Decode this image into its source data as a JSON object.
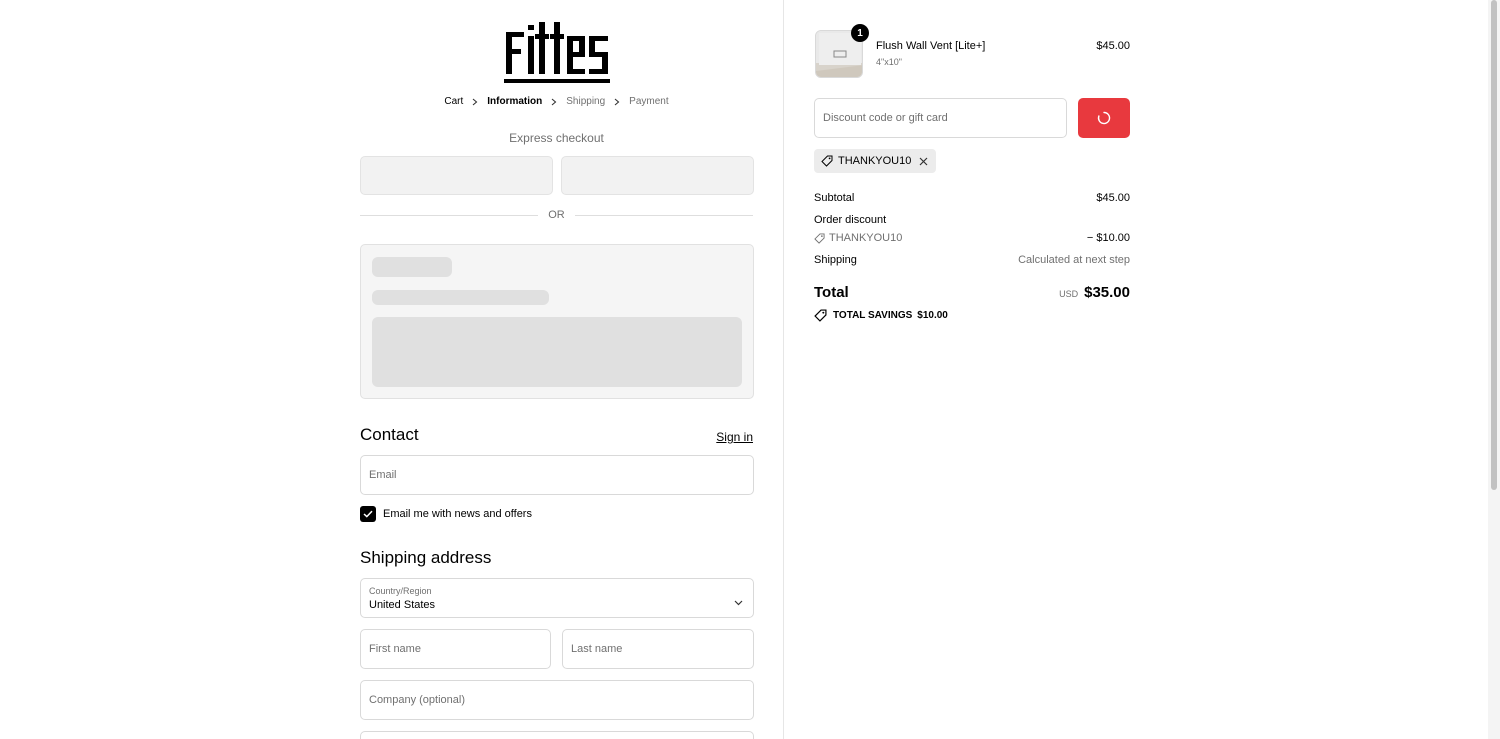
{
  "brand": {
    "logo_text": "Fittes"
  },
  "breadcrumb": {
    "items": [
      "Cart",
      "Information",
      "Shipping",
      "Payment"
    ]
  },
  "express": {
    "title": "Express checkout",
    "or_label": "OR"
  },
  "contact": {
    "title": "Contact",
    "sign_in": "Sign in",
    "email_placeholder": "Email",
    "newsletter_label": "Email me with news and offers",
    "newsletter_checked": true
  },
  "shipping_address": {
    "title": "Shipping address",
    "country_label": "Country/Region",
    "country_value": "United States",
    "first_name_placeholder": "First name",
    "last_name_placeholder": "Last name",
    "company_placeholder": "Company (optional)"
  },
  "order": {
    "product": {
      "quantity": "1",
      "name": "Flush Wall Vent [Lite+]",
      "variant": "4\"x10\"",
      "price": "$45.00"
    },
    "discount_placeholder": "Discount code or gift card",
    "applied_code": "THANKYOU10",
    "subtotal_label": "Subtotal",
    "subtotal_value": "$45.00",
    "order_discount_label": "Order discount",
    "discount_code": "THANKYOU10",
    "discount_value": "− $10.00",
    "shipping_label": "Shipping",
    "shipping_value": "Calculated at next step",
    "total_label": "Total",
    "currency": "USD",
    "total_value": "$35.00",
    "savings_label": "TOTAL SAVINGS",
    "savings_value": "$10.00"
  },
  "colors": {
    "apply_button": "#e8393e",
    "accent": "#000000"
  }
}
